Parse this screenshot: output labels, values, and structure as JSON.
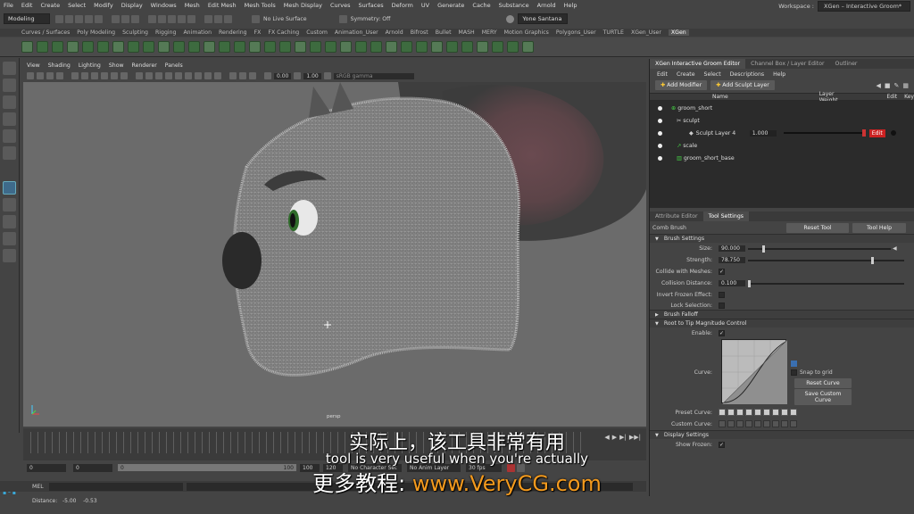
{
  "menubar": {
    "items": [
      "File",
      "Edit",
      "Create",
      "Select",
      "Modify",
      "Display",
      "Windows",
      "Mesh",
      "Edit Mesh",
      "Mesh Tools",
      "Mesh Display",
      "Curves",
      "Surfaces",
      "Deform",
      "UV",
      "Generate",
      "Cache",
      "Substance",
      "Arnold",
      "Help"
    ],
    "workspace_label": "Workspace :",
    "workspace_value": "XGen – Interactive Groom*"
  },
  "statusline": {
    "mode": "Modeling",
    "live_surface": "No Live Surface",
    "symmetry": "Symmetry: Off",
    "user": "Yone Santana"
  },
  "shelf": {
    "tabs": [
      "Curves / Surfaces",
      "Poly Modeling",
      "Sculpting",
      "Rigging",
      "Animation",
      "Rendering",
      "FX",
      "FX Caching",
      "Custom",
      "Animation_User",
      "Arnold",
      "Bifrost",
      "Bullet",
      "MASH",
      "MERY",
      "Motion Graphics",
      "Polygons_User",
      "TURTLE",
      "XGen_User",
      "XGen"
    ],
    "active_tab": "XGen"
  },
  "viewport": {
    "menu": [
      "View",
      "Shading",
      "Lighting",
      "Show",
      "Renderer",
      "Panels"
    ],
    "field_a": "0.00",
    "field_b": "1.00",
    "color_space": "sRGB gamma",
    "camera": "persp"
  },
  "timeline": {
    "current_frame": "1"
  },
  "range": {
    "start": "0",
    "start_inner": "0",
    "end_inner": "100",
    "end": "100",
    "end_outer": "120",
    "character_set": "No Character Set",
    "anim_layer": "No Anim Layer",
    "fps": "30 fps"
  },
  "cmdline": {
    "label": "MEL"
  },
  "helpline": {
    "text": "Distance:   -5.00    -0.53"
  },
  "panel": {
    "tabs": [
      "XGen Interactive Groom Editor",
      "Channel Box / Layer Editor",
      "Outliner"
    ],
    "menu": [
      "Edit",
      "Create",
      "Select",
      "Descriptions",
      "Help"
    ],
    "add_modifier": "Add Modifier",
    "add_sculpt_layer": "Add Sculpt Layer",
    "col_name": "Name",
    "col_weight": "Layer Weight",
    "col_edit": "Edit",
    "col_key": "Key",
    "layers": [
      {
        "name": "groom_short",
        "indent": 0
      },
      {
        "name": "sculpt",
        "indent": 1
      },
      {
        "name": "Sculpt Layer 4",
        "indent": 2,
        "weight": "1.000",
        "edit": "Edit"
      },
      {
        "name": "scale",
        "indent": 1
      },
      {
        "name": "groom_short_base",
        "indent": 1
      }
    ]
  },
  "tool": {
    "tabs": [
      "Attribute Editor",
      "Tool Settings"
    ],
    "name": "Comb Brush",
    "reset": "Reset Tool",
    "help": "Tool Help",
    "sections": {
      "brush": "Brush Settings",
      "falloff": "Brush Falloff",
      "root_tip": "Root to Tip Magnitude Control",
      "display": "Display Settings"
    },
    "size_label": "Size:",
    "size": "90.000",
    "size_level": 0.1,
    "strength_label": "Strength:",
    "strength": "78.750",
    "strength_level": 0.79,
    "collide_label": "Collide with Meshes:",
    "collision_label": "Collision Distance:",
    "collision": "0.100",
    "collision_level": 0.0,
    "invert_label": "Invert Frozen Effect:",
    "lock_label": "Lock Selection:",
    "enable_label": "Enable:",
    "curve_label": "Curve:",
    "snap": "Snap to grid",
    "reset_curve": "Reset Curve",
    "save_curve": "Save Custom Curve",
    "preset_label": "Preset Curve:",
    "custom_label": "Custom Curve:",
    "show_frozen_label": "Show Frozen:"
  },
  "subtitles": {
    "cn": "实际上，该工具非常有用",
    "en": "tool is very useful when you're actually",
    "brand_cn": "更多教程:",
    "brand_url": "www.VeryCG.com"
  },
  "colors": {
    "maya_blue": "#3aa7d6",
    "edit_red": "#cc2222",
    "brand_orange": "#f39a1e"
  }
}
